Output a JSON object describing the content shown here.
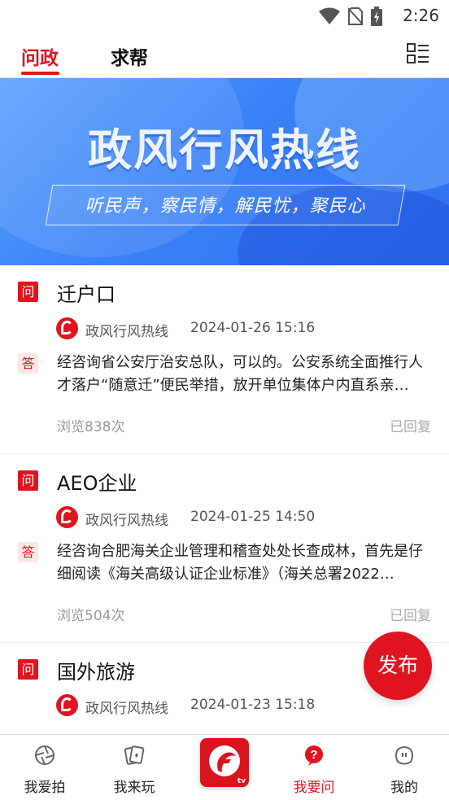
{
  "status_bar": {
    "time": "2:26"
  },
  "top_tabs": [
    {
      "label": "问政",
      "active": true
    },
    {
      "label": "求帮",
      "active": false
    }
  ],
  "banner": {
    "title": "政风行风热线",
    "slogan": "听民声，察民情，解民忧，聚民心"
  },
  "badges": {
    "question": "问",
    "answer": "答"
  },
  "questions": [
    {
      "title": "迁户口",
      "author": "政风行风热线",
      "time": "2024-01-26 15:16",
      "answer": "经咨询省公安厅治安总队，可以的。公安系统全面推行人才落户“随意迁”便民举措，放开单位集体户内直系亲…",
      "views": "浏览838次",
      "status": "已回复"
    },
    {
      "title": "AEO企业",
      "author": "政风行风热线",
      "time": "2024-01-25 14:50",
      "answer": "经咨询合肥海关企业管理和稽查处处长查成林，首先是仔细阅读《海关高级认证企业标准》（海关总署2022…",
      "views": "浏览504次",
      "status": "已回复"
    },
    {
      "title": "国外旅游",
      "author": "政风行风热线",
      "time": "2024-01-23 15:18"
    }
  ],
  "publish_button": "发布",
  "bottom_nav": [
    {
      "label": "我爱拍",
      "icon": "camera-aperture-icon"
    },
    {
      "label": "我来玩",
      "icon": "cards-icon"
    },
    {
      "label": "",
      "icon": "anhui-tv-logo"
    },
    {
      "label": "我要问",
      "icon": "question-icon",
      "active": true
    },
    {
      "label": "我的",
      "icon": "profile-icon"
    }
  ],
  "colors": {
    "accent": "#e0141e",
    "banner_blue": "#3a82f7"
  },
  "center_logo_text": "tv"
}
